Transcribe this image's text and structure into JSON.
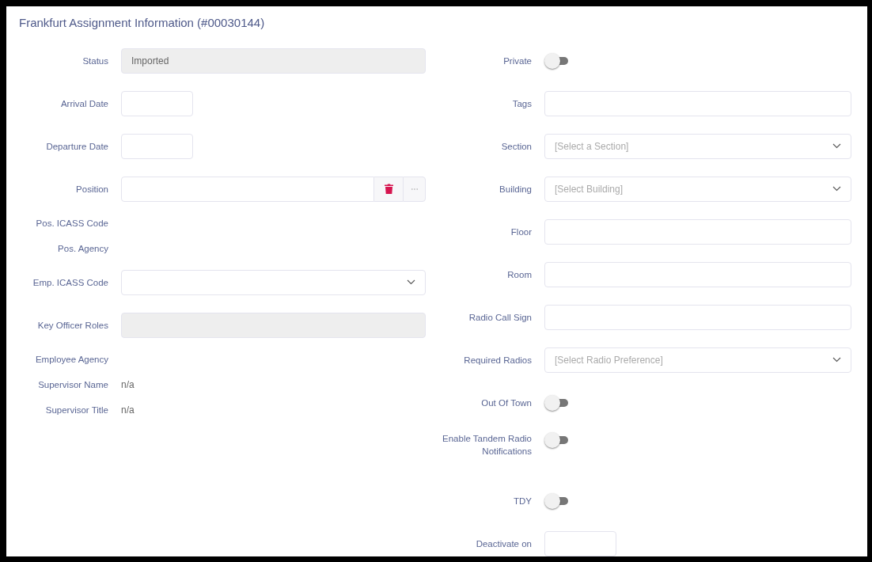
{
  "title": "Frankfurt Assignment Information (#00030144)",
  "left": [
    {
      "kind": "readonly",
      "label": "Status",
      "value": "Imported"
    },
    {
      "kind": "date",
      "label": "Arrival Date"
    },
    {
      "kind": "date",
      "label": "Departure Date"
    },
    {
      "kind": "position",
      "label": "Position"
    },
    {
      "kind": "text",
      "label": "Pos. ICASS Code"
    },
    {
      "kind": "text",
      "label": "Pos. Agency"
    },
    {
      "kind": "select",
      "label": "Emp. ICASS Code"
    },
    {
      "kind": "readonly",
      "label": "Key Officer Roles"
    },
    {
      "kind": "text",
      "label": "Employee Agency"
    },
    {
      "kind": "text",
      "label": "Supervisor Name",
      "value": "n/a"
    },
    {
      "kind": "text",
      "label": "Supervisor Title",
      "value": "n/a"
    }
  ],
  "right": [
    {
      "kind": "toggle",
      "label": "Private",
      "on": false
    },
    {
      "kind": "input",
      "label": "Tags"
    },
    {
      "kind": "select",
      "label": "Section",
      "placeholder": "[Select a Section]"
    },
    {
      "kind": "select",
      "label": "Building",
      "placeholder": "[Select Building]"
    },
    {
      "kind": "input",
      "label": "Floor"
    },
    {
      "kind": "input",
      "label": "Room"
    },
    {
      "kind": "input",
      "label": "Radio Call Sign"
    },
    {
      "kind": "select",
      "label": "Required Radios",
      "placeholder": "[Select Radio Preference]"
    },
    {
      "kind": "toggle",
      "label": "Out Of Town",
      "on": false
    },
    {
      "kind": "toggle",
      "label": "Enable Tandem Radio Notifications",
      "on": false
    },
    {
      "kind": "toggle",
      "label": "TDY",
      "on": false
    },
    {
      "kind": "date",
      "label": "Deactivate on"
    }
  ]
}
